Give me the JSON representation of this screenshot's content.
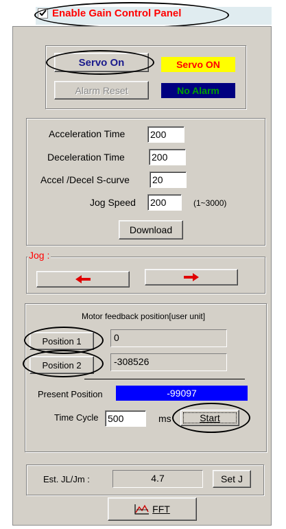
{
  "enable_panel": {
    "label": "Enable Gain Control Panel",
    "checked": true,
    "color": "#ff0000"
  },
  "servo": {
    "servo_on_button": "Servo On",
    "servo_status": "Servo ON",
    "servo_status_bg": "#ffff00",
    "servo_status_fg": "#ff0000",
    "alarm_reset_button": "Alarm Reset",
    "alarm_status": "No Alarm",
    "alarm_status_bg": "#000080",
    "alarm_status_fg": "#00a000"
  },
  "params": {
    "acceleration_label": "Acceleration Time",
    "acceleration_value": "200",
    "deceleration_label": "Deceleration Time",
    "deceleration_value": "200",
    "scurve_label": "Accel /Decel S-curve",
    "scurve_value": "20",
    "jog_speed_label": "Jog Speed",
    "jog_speed_value": "200",
    "jog_speed_range": "(1~3000)",
    "download_button": "Download"
  },
  "jog": {
    "title": "Jog :"
  },
  "position": {
    "header": "Motor feedback position[user unit]",
    "position1_button": "Position 1",
    "position1_value": "0",
    "position2_button": "Position 2",
    "position2_value": "-308526",
    "present_label": "Present Position",
    "present_value": "-99097",
    "present_bg": "#0000ff",
    "time_cycle_label": "Time Cycle",
    "time_cycle_value": "500",
    "time_cycle_unit": "ms",
    "start_button": "Start"
  },
  "inertia": {
    "label": "Est. JL/Jm :",
    "value": "4.7",
    "set_button": "Set J"
  },
  "fft": {
    "button": "FFT"
  }
}
